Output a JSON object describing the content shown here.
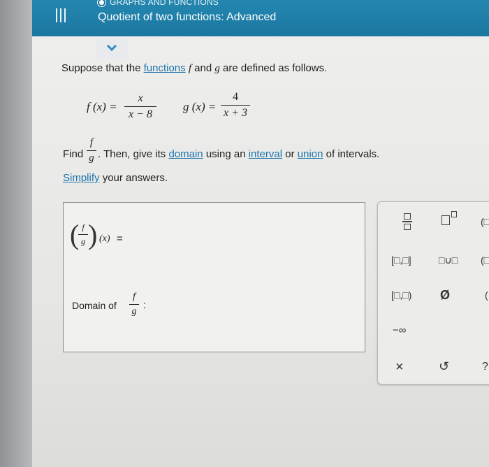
{
  "header": {
    "section": "GRAPHS AND FUNCTIONS",
    "title": "Quotient of two functions: Advanced"
  },
  "problem": {
    "intro_1": "Suppose that the ",
    "functions_link": "functions",
    "intro_2": "and",
    "intro_3": "are defined as follows.",
    "f_name": "f",
    "g_name": "g",
    "f_lhs": "f (x) =",
    "f_num": "x",
    "f_den": "x − 8",
    "g_lhs": "g (x) =",
    "g_num": "4",
    "g_den": "x + 3",
    "find": "Find",
    "then": ". Then, give its",
    "domain_link": "domain",
    "using": "using an",
    "interval_link": "interval",
    "or": "or",
    "union_link": "union",
    "of_intervals": "of intervals.",
    "simplify_link": "Simplify",
    "your_answers": "your answers."
  },
  "answer": {
    "lhs_f": "f",
    "lhs_g": "g",
    "lhs_x": "(x)",
    "equals": "=",
    "domain_label": "Domain of",
    "colon": ":"
  },
  "keypad": {
    "interval_closed": "[□,□]",
    "union": "□∪□",
    "interval_half": "[□,□)",
    "empty_set": "Ø",
    "neg_inf": "−∞",
    "clear": "×",
    "undo": "↺",
    "partial_1": "(□",
    "partial_2": "(□",
    "partial_3": "(",
    "partial_4": "?"
  },
  "colors": {
    "header": "#1f80a8",
    "link": "#1e74ad",
    "chevron": "#2f8fc6"
  }
}
